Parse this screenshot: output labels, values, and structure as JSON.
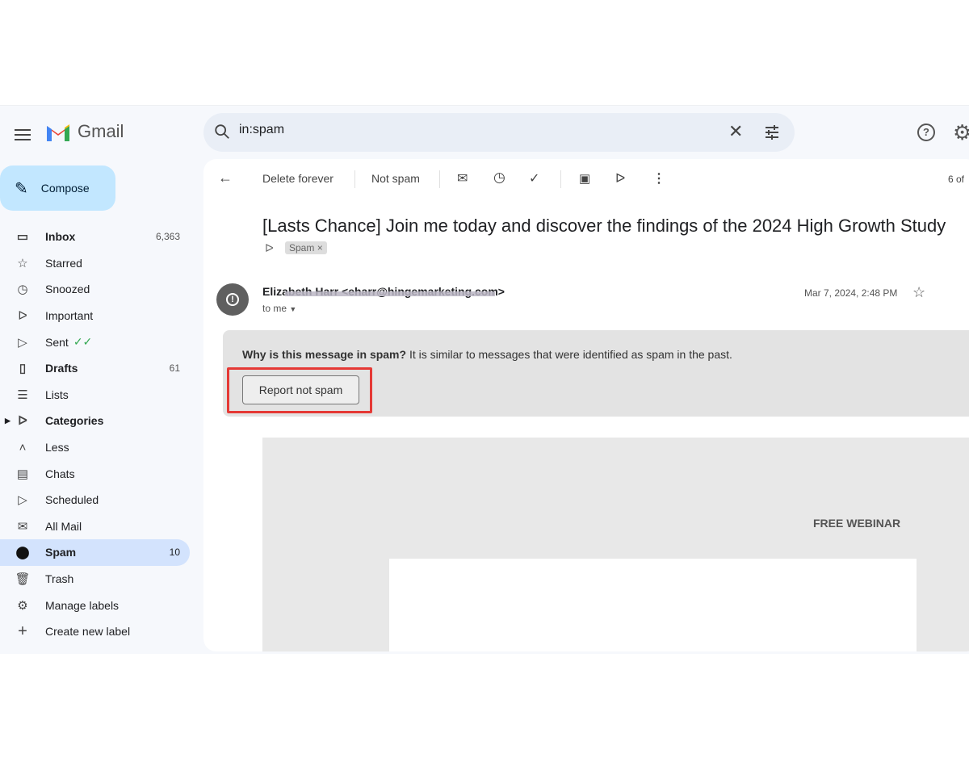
{
  "header": {
    "app_name": "Gmail",
    "search_value": "in:spam"
  },
  "compose_label": "Compose",
  "sidebar": {
    "items": [
      {
        "label": "Inbox",
        "count": "6,363",
        "icon": "inbox-icon"
      },
      {
        "label": "Starred",
        "icon": "star-icon"
      },
      {
        "label": "Snoozed",
        "icon": "clock-icon"
      },
      {
        "label": "Important",
        "icon": "label-important-icon"
      },
      {
        "label": "Sent",
        "icon": "send-icon"
      },
      {
        "label": "Drafts",
        "count": "61",
        "icon": "draft-icon"
      },
      {
        "label": "Lists",
        "icon": "list-icon"
      },
      {
        "label": "Categories",
        "icon": "label-icon"
      },
      {
        "label": "Less",
        "icon": "chevron-up-icon"
      },
      {
        "label": "Chats",
        "icon": "chat-icon"
      },
      {
        "label": "Scheduled",
        "icon": "scheduled-send-icon"
      },
      {
        "label": "All Mail",
        "icon": "all-mail-icon"
      },
      {
        "label": "Spam",
        "count": "10",
        "icon": "spam-icon"
      },
      {
        "label": "Trash",
        "icon": "trash-icon"
      },
      {
        "label": "Manage labels",
        "icon": "gear-icon"
      },
      {
        "label": "Create new label",
        "icon": "plus-icon"
      }
    ]
  },
  "toolbar": {
    "delete_forever": "Delete forever",
    "not_spam": "Not spam",
    "pager": "6 of"
  },
  "message": {
    "subject": "[Lasts Chance] Join me today and discover the findings of the 2024 High Growth Study",
    "label_chip": "Spam",
    "sender": "Elizabeth Harr <eharr@hingemarketing.com>",
    "to": "to me",
    "date": "Mar 7, 2024, 2:48 PM",
    "spam_question": "Why is this message in spam?",
    "spam_reason": "It is similar to messages that were identified as spam in the past.",
    "report_not_spam": "Report not spam",
    "body_heading": "FREE WEBINAR"
  },
  "colors": {
    "compose": "#c2e7ff",
    "selected": "#d3e3fd",
    "highlight": "#e53935"
  }
}
